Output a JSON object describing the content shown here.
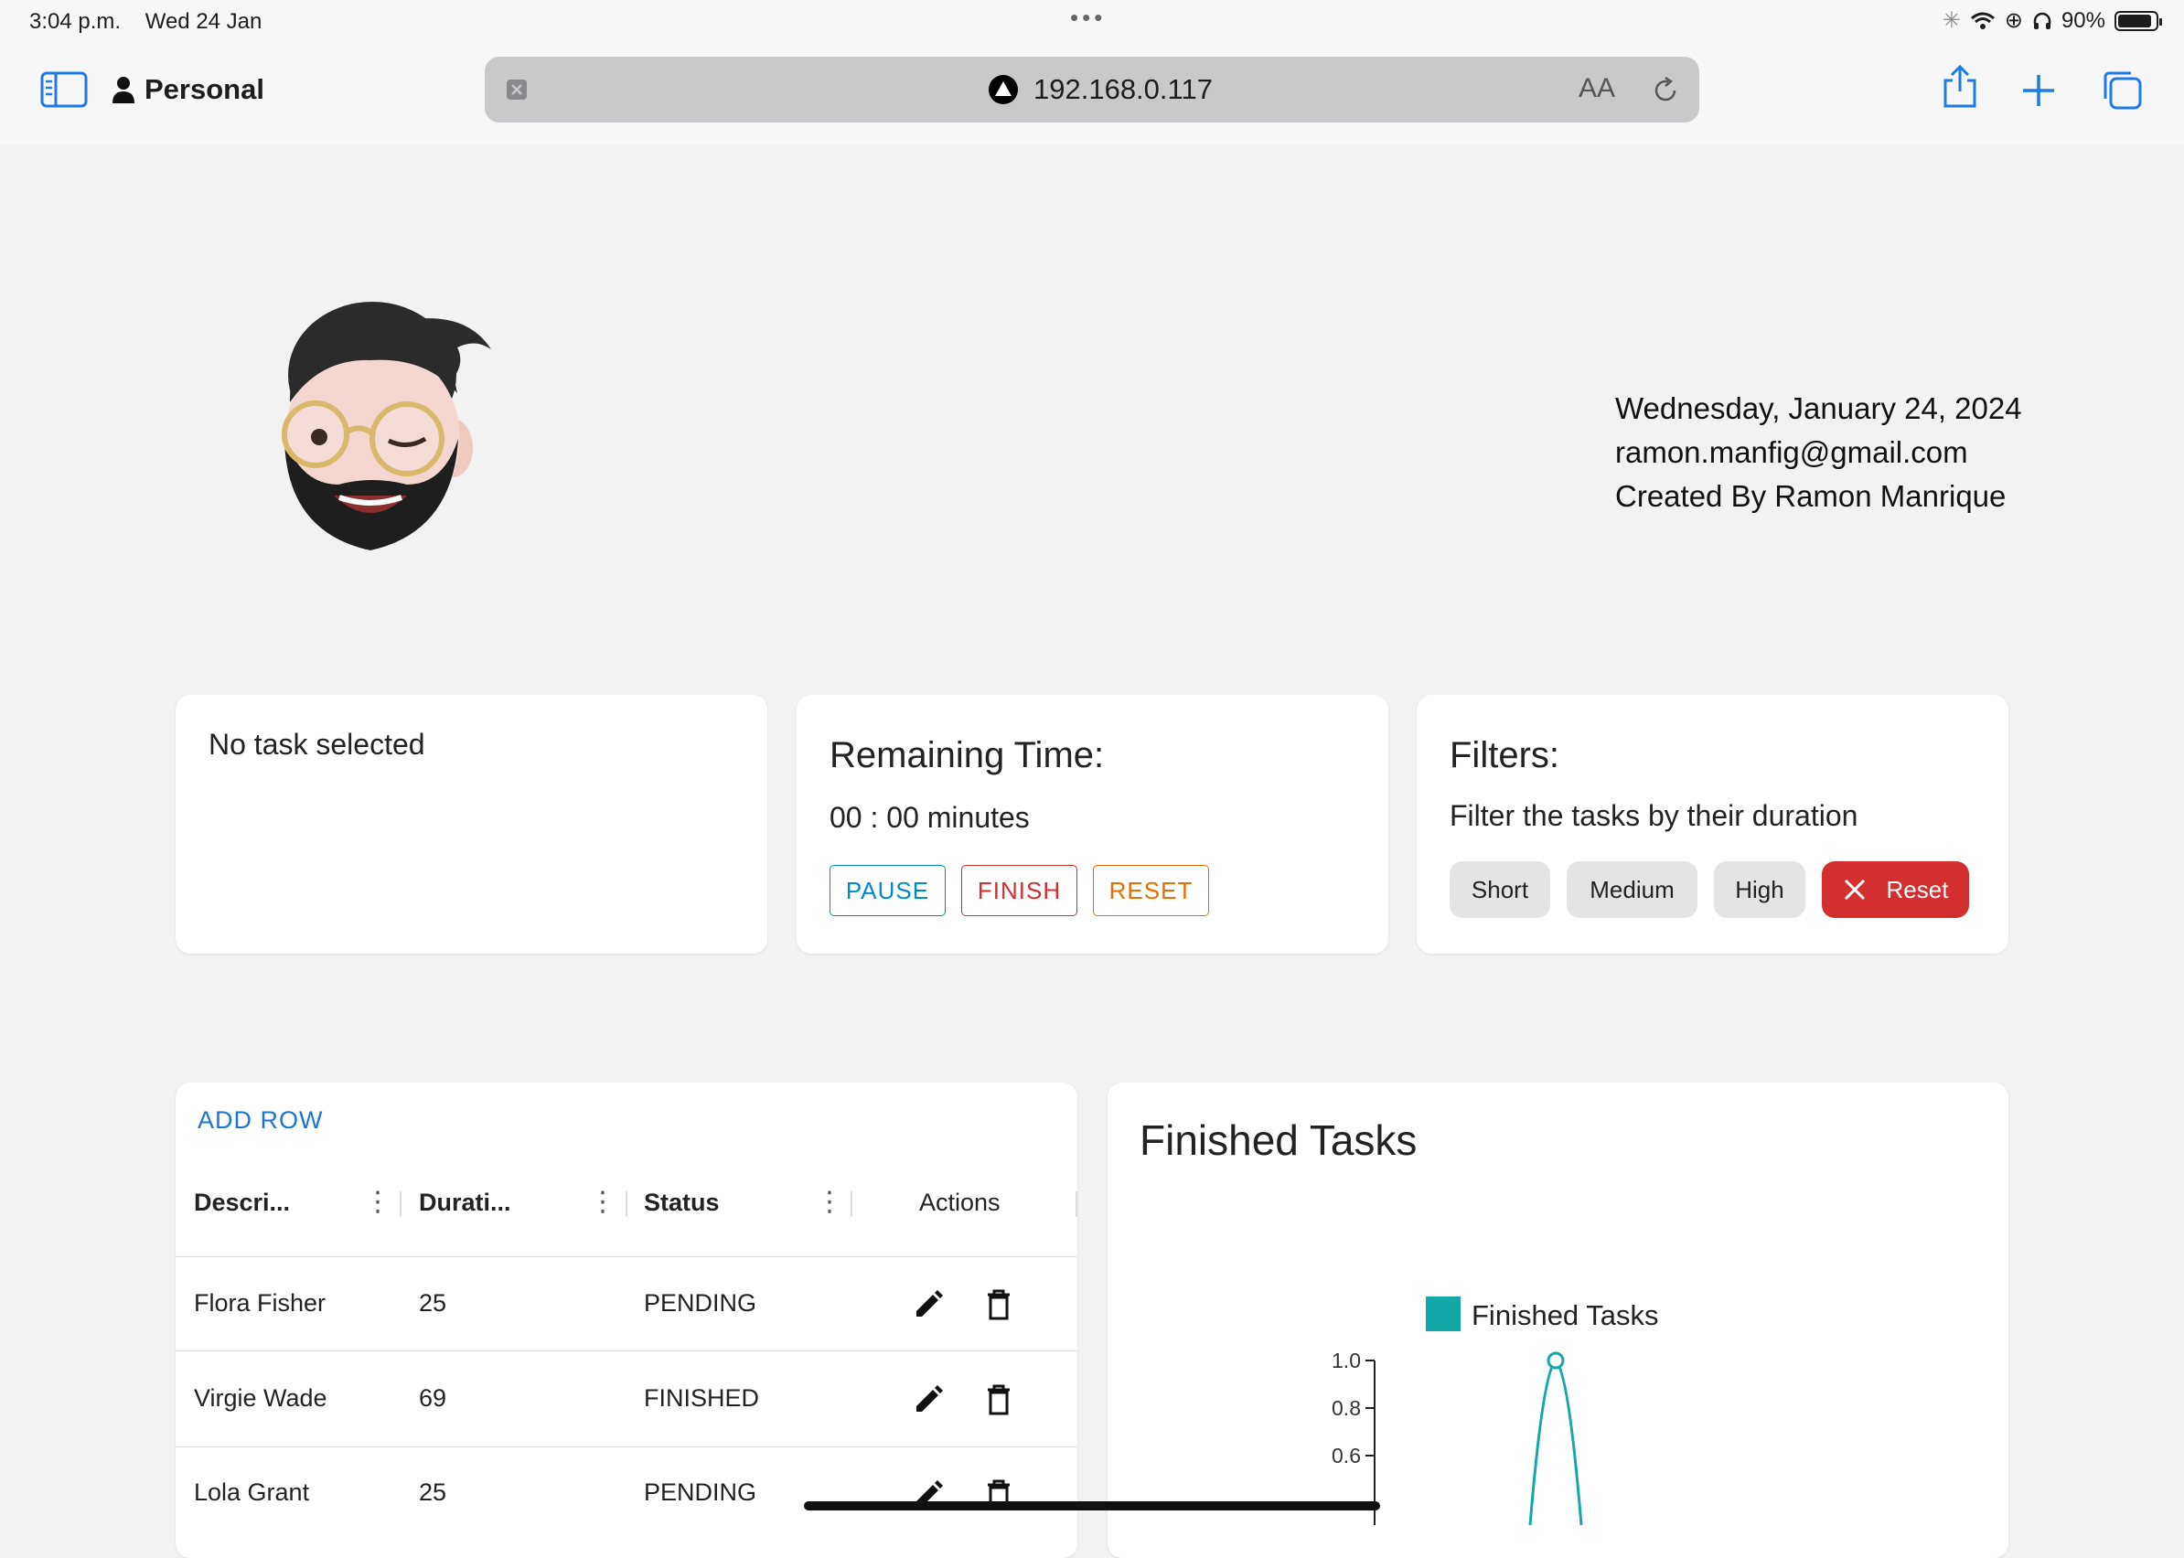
{
  "status_bar": {
    "time": "3:04 p.m.",
    "date": "Wed 24 Jan",
    "battery": "90%",
    "battery_level": 0.9
  },
  "browser": {
    "profile_label": "Personal",
    "url": "192.168.0.117",
    "text_size_label": "AA"
  },
  "header": {
    "date": "Wednesday, January 24, 2024",
    "email": "ramon.manfig@gmail.com",
    "credit": "Created By Ramon Manrique"
  },
  "task_card": {
    "text": "No task selected"
  },
  "timer_card": {
    "title": "Remaining Time:",
    "time": "00 : 00 minutes",
    "pause_label": "PAUSE",
    "finish_label": "FINISH",
    "reset_label": "RESET"
  },
  "filters_card": {
    "title": "Filters:",
    "subtitle": "Filter the tasks by their duration",
    "short_label": "Short",
    "medium_label": "Medium",
    "high_label": "High",
    "reset_label": "Reset"
  },
  "table": {
    "add_row_label": "ADD ROW",
    "columns": [
      "Descri...",
      "Durati...",
      "Status",
      "Actions"
    ],
    "rows": [
      {
        "description": "Flora Fisher",
        "duration": "25",
        "status": "PENDING"
      },
      {
        "description": "Virgie Wade",
        "duration": "69",
        "status": "FINISHED"
      },
      {
        "description": "Lola Grant",
        "duration": "25",
        "status": "PENDING"
      }
    ]
  },
  "chart_card": {
    "title": "Finished Tasks"
  },
  "chart_data": {
    "type": "line",
    "title": "Finished Tasks",
    "series": [
      {
        "name": "Finished Tasks",
        "values": [
          1.0
        ]
      }
    ],
    "y_ticks": [
      "1.0",
      "0.8",
      "0.6"
    ],
    "color": "#12a8a8"
  },
  "colors": {
    "accent_blue": "#1976d2",
    "pause": "#0288d1",
    "finish": "#d32f2f",
    "reset": "#ed6c02",
    "filter_reset": "#d32f2f",
    "chart_series": "#12a8a8"
  }
}
